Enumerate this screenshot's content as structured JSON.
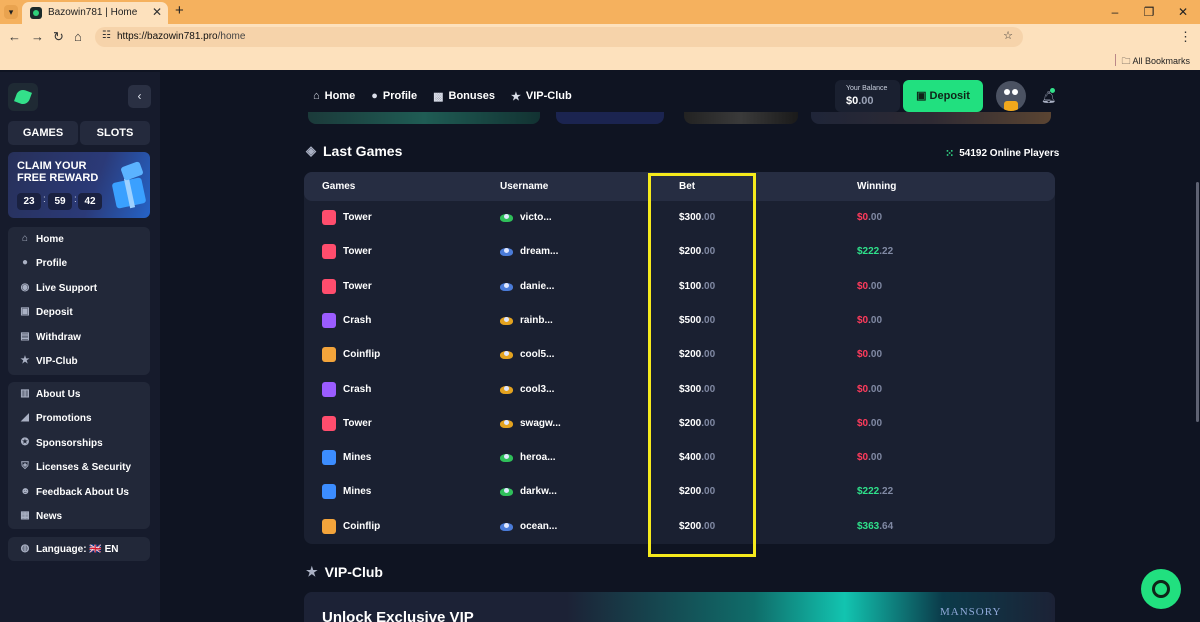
{
  "browser": {
    "tab_title": "Bazowin781 | Home",
    "tab_close": "✕",
    "new_tab": "+",
    "url_host": "https://bazowin781.pro",
    "url_path": "/home",
    "bookmarks_label": "All Bookmarks"
  },
  "sidebar": {
    "tabs": [
      "GAMES",
      "SLOTS"
    ],
    "promo": {
      "title": "CLAIM YOUR FREE REWARD",
      "hours": "23",
      "minutes": "59",
      "seconds": "42"
    },
    "menu1": [
      {
        "label": "Home",
        "icon": "home-icon"
      },
      {
        "label": "Profile",
        "icon": "user-icon"
      },
      {
        "label": "Live Support",
        "icon": "headset-icon"
      },
      {
        "label": "Deposit",
        "icon": "wallet-icon"
      },
      {
        "label": "Withdraw",
        "icon": "withdraw-icon"
      },
      {
        "label": "VIP-Club",
        "icon": "star-icon"
      }
    ],
    "menu2": [
      {
        "label": "About Us",
        "icon": "book-icon"
      },
      {
        "label": "Promotions",
        "icon": "megaphone-icon"
      },
      {
        "label": "Sponsorships",
        "icon": "handshake-icon"
      },
      {
        "label": "Licenses & Security",
        "icon": "shield-icon"
      },
      {
        "label": "Feedback About Us",
        "icon": "feedback-icon"
      },
      {
        "label": "News",
        "icon": "news-icon"
      }
    ],
    "language": "Language: 🇬🇧 EN"
  },
  "header": {
    "nav": [
      "Home",
      "Profile",
      "Bonuses",
      "VIP-Club"
    ],
    "balance_label": "Your Balance",
    "balance_int": "$0",
    "balance_dec": ".00",
    "deposit_label": "Deposit"
  },
  "last_games": {
    "title": "Last Games",
    "online": "54192 Online Players",
    "columns": [
      "Games",
      "Username",
      "Bet",
      "Winning"
    ],
    "rows": [
      {
        "game": "Tower",
        "user": "victo...",
        "bet": "$300",
        "bet_dec": ".00",
        "win": "$0",
        "win_dec": ".00",
        "win_positive": false
      },
      {
        "game": "Tower",
        "user": "dream...",
        "bet": "$200",
        "bet_dec": ".00",
        "win": "$222",
        "win_dec": ".22",
        "win_positive": true
      },
      {
        "game": "Tower",
        "user": "danie...",
        "bet": "$100",
        "bet_dec": ".00",
        "win": "$0",
        "win_dec": ".00",
        "win_positive": false
      },
      {
        "game": "Crash",
        "user": "rainb...",
        "bet": "$500",
        "bet_dec": ".00",
        "win": "$0",
        "win_dec": ".00",
        "win_positive": false
      },
      {
        "game": "Coinflip",
        "user": "cool5...",
        "bet": "$200",
        "bet_dec": ".00",
        "win": "$0",
        "win_dec": ".00",
        "win_positive": false
      },
      {
        "game": "Crash",
        "user": "cool3...",
        "bet": "$300",
        "bet_dec": ".00",
        "win": "$0",
        "win_dec": ".00",
        "win_positive": false
      },
      {
        "game": "Tower",
        "user": "swagw...",
        "bet": "$200",
        "bet_dec": ".00",
        "win": "$0",
        "win_dec": ".00",
        "win_positive": false
      },
      {
        "game": "Mines",
        "user": "heroa...",
        "bet": "$400",
        "bet_dec": ".00",
        "win": "$0",
        "win_dec": ".00",
        "win_positive": false
      },
      {
        "game": "Mines",
        "user": "darkw...",
        "bet": "$200",
        "bet_dec": ".00",
        "win": "$222",
        "win_dec": ".22",
        "win_positive": true
      },
      {
        "game": "Coinflip",
        "user": "ocean...",
        "bet": "$200",
        "bet_dec": ".00",
        "win": "$363",
        "win_dec": ".64",
        "win_positive": true
      }
    ]
  },
  "vip": {
    "title": "VIP-Club",
    "banner_text": "Unlock Exclusive VIP",
    "partner": "MANSORY"
  },
  "colors": {
    "accent": "#21e07f",
    "loss": "#ff3b5c",
    "win": "#2fe08a",
    "highlight": "#f5ea1c",
    "game_colors": {
      "Tower": "#ff4d6d",
      "Crash": "#9b5cff",
      "Coinflip": "#f3a43b",
      "Mines": "#3c8dff"
    },
    "rank_colors": [
      "#2fbf5a",
      "#4a7bd8",
      "#4a7bd8",
      "#e3a21f",
      "#e3a21f",
      "#e3a21f",
      "#e3a21f",
      "#2fbf5a",
      "#2fbf5a",
      "#4a7bd8"
    ]
  }
}
